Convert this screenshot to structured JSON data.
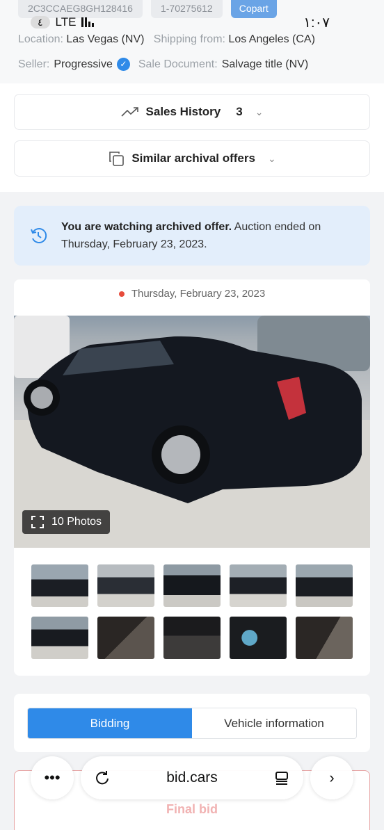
{
  "top_chips": [
    "2C3CCAEG8GH128416",
    "1-70275612",
    "Copart"
  ],
  "status_bar": {
    "network_pill": "٤",
    "network": "LTE",
    "time": "١:٠٧"
  },
  "info": {
    "location_label": "Location:",
    "location_value": "Las Vegas (NV)",
    "shipping_label": "Shipping from:",
    "shipping_value": "Los Angeles (CA)",
    "seller_label": "Seller:",
    "seller_value": "Progressive",
    "sale_doc_label": "Sale Document:",
    "sale_doc_value": "Salvage title (NV)"
  },
  "expanders": {
    "sales_history_label": "Sales History",
    "sales_history_count": "3",
    "similar_label": "Similar archival offers"
  },
  "notice": {
    "bold": "You are watching archived offer.",
    "rest": " Auction ended on Thursday, February 23, 2023."
  },
  "gallery": {
    "date": "Thursday, February 23, 2023",
    "photos_label": "10 Photos"
  },
  "tabs": [
    "Bidding",
    "Vehicle information"
  ],
  "final_label": "Final bid",
  "browser": {
    "url": "bid.cars"
  },
  "colors": {
    "accent": "#2f8ae8",
    "notice_bg": "#e3eefb",
    "final_border": "#e7a3a3"
  }
}
